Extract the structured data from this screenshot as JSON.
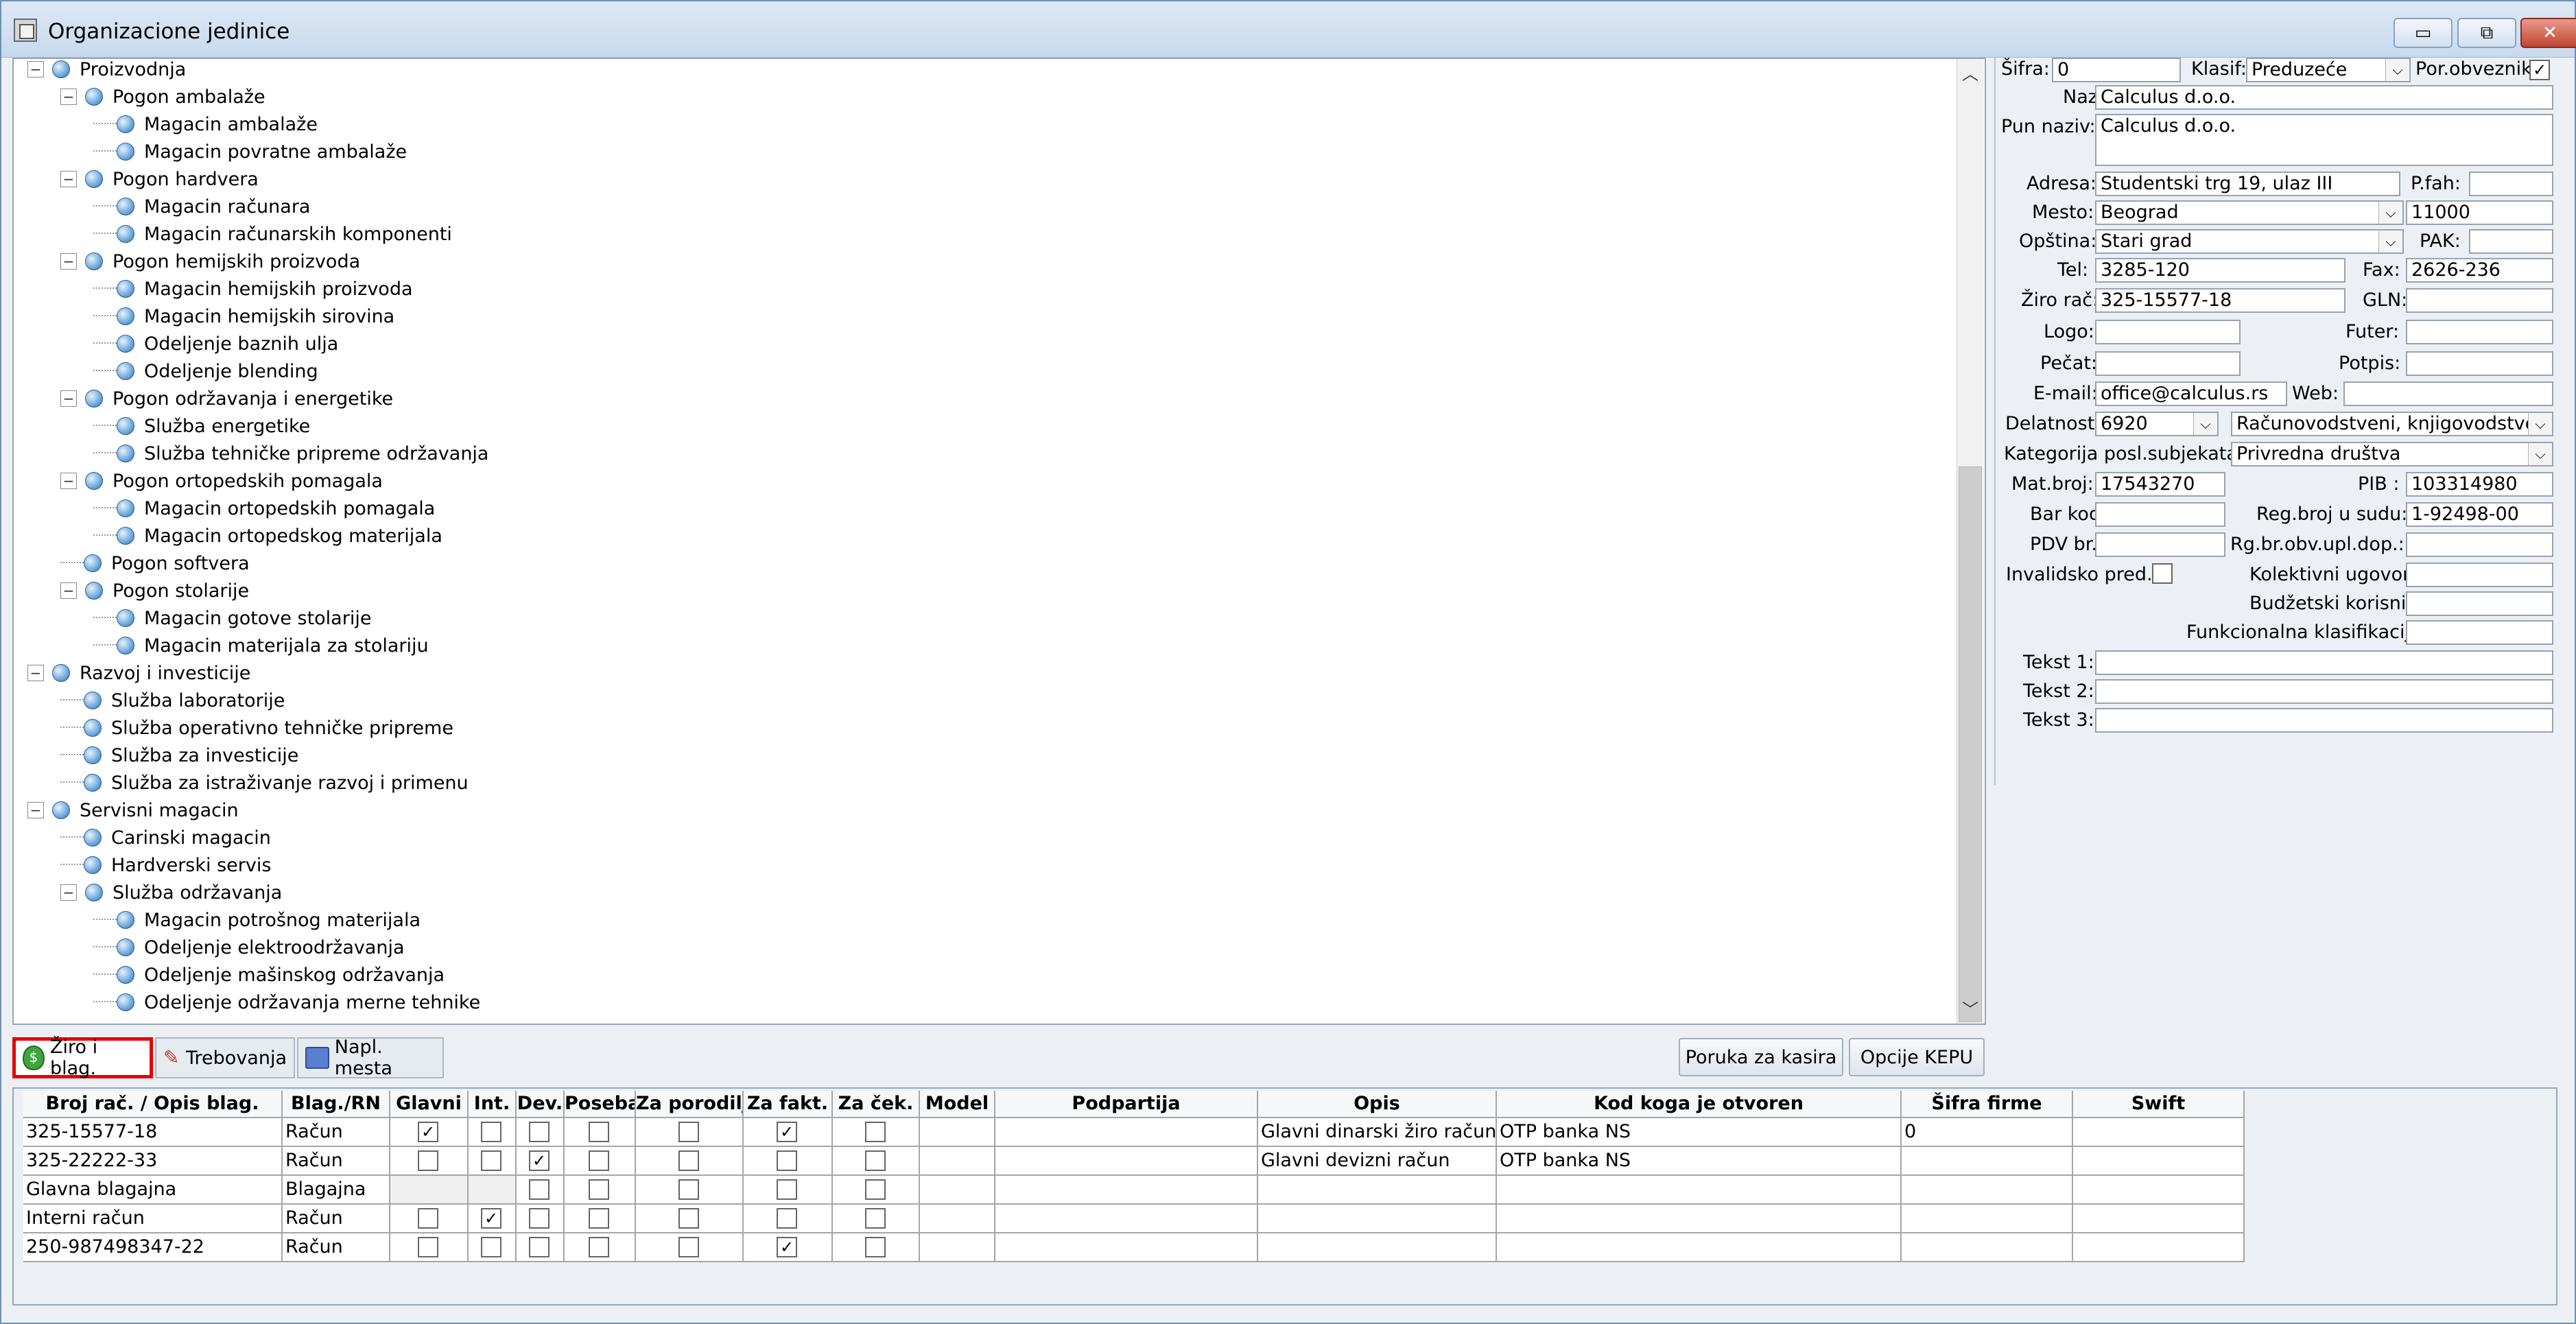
{
  "window": {
    "title": "Organizacione jedinice",
    "title_buttons": [
      "▭",
      "⧉",
      "✕"
    ]
  },
  "tree": [
    {
      "label": "Proizvodnja",
      "level": 0,
      "expandable": true
    },
    {
      "label": "Pogon ambalaže",
      "level": 1,
      "expandable": true
    },
    {
      "label": "Magacin ambalaže",
      "level": 2,
      "expandable": false
    },
    {
      "label": "Magacin povratne ambalaže",
      "level": 2,
      "expandable": false
    },
    {
      "label": "Pogon hardvera",
      "level": 1,
      "expandable": true
    },
    {
      "label": "Magacin računara",
      "level": 2,
      "expandable": false
    },
    {
      "label": "Magacin računarskih komponenti",
      "level": 2,
      "expandable": false
    },
    {
      "label": "Pogon hemijskih proizvoda",
      "level": 1,
      "expandable": true
    },
    {
      "label": "Magacin hemijskih proizvoda",
      "level": 2,
      "expandable": false
    },
    {
      "label": "Magacin hemijskih sirovina",
      "level": 2,
      "expandable": false
    },
    {
      "label": "Odeljenje baznih ulja",
      "level": 2,
      "expandable": false
    },
    {
      "label": "Odeljenje blending",
      "level": 2,
      "expandable": false
    },
    {
      "label": "Pogon održavanja i energetike",
      "level": 1,
      "expandable": true
    },
    {
      "label": "Služba energetike",
      "level": 2,
      "expandable": false
    },
    {
      "label": "Služba tehničke pripreme održavanja",
      "level": 2,
      "expandable": false
    },
    {
      "label": "Pogon ortopedskih pomagala",
      "level": 1,
      "expandable": true
    },
    {
      "label": "Magacin ortopedskih pomagala",
      "level": 2,
      "expandable": false
    },
    {
      "label": "Magacin ortopedskog materijala",
      "level": 2,
      "expandable": false
    },
    {
      "label": "Pogon softvera",
      "level": 1,
      "expandable": false
    },
    {
      "label": "Pogon stolarije",
      "level": 1,
      "expandable": true
    },
    {
      "label": "Magacin gotove stolarije",
      "level": 2,
      "expandable": false
    },
    {
      "label": "Magacin materijala za stolariju",
      "level": 2,
      "expandable": false
    },
    {
      "label": "Razvoj i investicije",
      "level": 0,
      "expandable": true
    },
    {
      "label": "Služba laboratorije",
      "level": 1,
      "expandable": false
    },
    {
      "label": "Služba operativno tehničke pripreme",
      "level": 1,
      "expandable": false
    },
    {
      "label": "Služba za investicije",
      "level": 1,
      "expandable": false
    },
    {
      "label": "Služba za istraživanje razvoj i primenu",
      "level": 1,
      "expandable": false
    },
    {
      "label": "Servisni magacin",
      "level": 0,
      "expandable": true
    },
    {
      "label": "Carinski magacin",
      "level": 1,
      "expandable": false
    },
    {
      "label": "Hardverski servis",
      "level": 1,
      "expandable": false
    },
    {
      "label": "Služba održavanja",
      "level": 1,
      "expandable": true
    },
    {
      "label": "Magacin potrošnog materijala",
      "level": 2,
      "expandable": false
    },
    {
      "label": "Odeljenje elektroodržavanja",
      "level": 2,
      "expandable": false
    },
    {
      "label": "Odeljenje mašinskog održavanja",
      "level": 2,
      "expandable": false
    },
    {
      "label": "Odeljenje održavanja merne tehnike",
      "level": 2,
      "expandable": false
    }
  ],
  "form": {
    "sifra_label": "Šifra:",
    "sifra": "0",
    "klasif_label": "Klasif:",
    "klasif": "Preduzeće",
    "porobv_label": "Por.obveznik:",
    "porobv_checked": "✓",
    "naziv_label": "Naziv:",
    "naziv": "Calculus d.o.o.",
    "punnaziv_label": "Pun naziv:",
    "punnaziv": "Calculus d.o.o.",
    "adresa_label": "Adresa:",
    "adresa": "Studentski trg 19, ulaz III",
    "pfah_label": "P.fah:",
    "pfah": "",
    "mesto_label": "Mesto:",
    "mesto": "Beograd",
    "ptt": "11000",
    "opstina_label": "Opština:",
    "opstina": "Stari grad",
    "pak_label": "PAK:",
    "pak": "",
    "tel_label": "Tel:",
    "tel": "3285-120",
    "fax_label": "Fax:",
    "fax": "2626-236",
    "ziro_label": "Žiro rač:",
    "ziro": "325-15577-18",
    "gln_label": "GLN:",
    "gln": "",
    "logo_label": "Logo:",
    "logo": "",
    "futer_label": "Futer:",
    "futer": "",
    "pecat_label": "Pečat:",
    "pecat": "",
    "potpis_label": "Potpis:",
    "potpis": "",
    "email_label": "E-mail:",
    "email": "office@calculus.rs",
    "web_label": "Web:",
    "web": "",
    "delatnost_label": "Delatnost:",
    "delatnost": "6920",
    "delatnost_opis": "Računovodstveni, knjigovodstven",
    "kategorija_label": "Kategorija posl.subjekata:",
    "kategorija": "Privredna društva",
    "matbroj_label": "Mat.broj:",
    "matbroj": "17543270",
    "pib_label": "PIB :",
    "pib": "103314980",
    "barkod_label": "Bar kod:",
    "barkod": "",
    "regbroj_label": "Reg.broj u sudu:",
    "regbroj": "1-92498-00",
    "pdv_label": "PDV br.:",
    "pdv": "",
    "rgbr_label": "Rg.br.obv.upl.dop.:",
    "rgbr": "",
    "invalid_label": "Invalidsko pred.:",
    "kolektivni_label": "Kolektivni ugovor:",
    "kolektivni": "",
    "budzetski_label": "Budžetski korisnik:",
    "budzetski": "",
    "funkcionalna_label": "Funkcionalna klasifikacija:",
    "funkcionalna": "",
    "tekst1_label": "Tekst 1:",
    "tekst1": "",
    "tekst2_label": "Tekst 2:",
    "tekst2": "",
    "tekst3_label": "Tekst 3:",
    "tekst3": ""
  },
  "tabs": [
    {
      "label": "Žiro i blag.",
      "icon": "money-bag-icon",
      "active": true
    },
    {
      "label": "Trebovanja",
      "icon": "wrench-icon",
      "active": false
    },
    {
      "label": "Napl. mesta",
      "icon": "cash-register-icon",
      "active": false
    }
  ],
  "buttons": {
    "poruka": "Poruka za kasira",
    "opcije": "Opcije KEPU"
  },
  "grid": {
    "columns": [
      "Broj rač. / Opis blag.",
      "Blag./RN",
      "Glavni",
      "Int.",
      "Dev.",
      "Poseban",
      "Za porodilje",
      "Za fakt.",
      "Za ček.",
      "Model",
      "Podpartija",
      "Opis",
      "Kod koga je otvoren",
      "Šifra firme",
      "Swift"
    ],
    "rows": [
      {
        "broj": " 325-15577-18",
        "blag": "Račun",
        "glavni": "✓",
        "int": "",
        "dev": "",
        "poseban": "",
        "porodilje": "",
        "fakt": "✓",
        "cek": "",
        "model": "",
        "podpartija": "",
        "opis": "Glavni dinarski žiro račun",
        "kod": "OTP banka NS",
        "sifra": "0",
        "swift": ""
      },
      {
        "broj": "325-22222-33",
        "blag": "Račun",
        "glavni": "",
        "int": "",
        "dev": "✓",
        "poseban": "",
        "porodilje": "",
        "fakt": "",
        "cek": "",
        "model": "",
        "podpartija": "",
        "opis": "Glavni devizni račun",
        "kod": "OTP banka NS",
        "sifra": "",
        "swift": ""
      },
      {
        "broj": "Glavna blagajna",
        "blag": "Blagajna",
        "glavni": null,
        "int": null,
        "dev": "",
        "poseban": "",
        "porodilje": "",
        "fakt": "",
        "cek": "",
        "model": "",
        "podpartija": "",
        "opis": "",
        "kod": "",
        "sifra": "",
        "swift": ""
      },
      {
        "broj": "Interni račun",
        "blag": "Račun",
        "glavni": "",
        "int": "✓",
        "dev": "",
        "poseban": "",
        "porodilje": "",
        "fakt": "",
        "cek": "",
        "model": "",
        "podpartija": "",
        "opis": "",
        "kod": "",
        "sifra": "",
        "swift": ""
      },
      {
        "broj": "250-987498347-22",
        "blag": "Račun",
        "glavni": "",
        "int": "",
        "dev": "",
        "poseban": "",
        "porodilje": "",
        "fakt": "✓",
        "cek": "",
        "model": "",
        "podpartija": "",
        "opis": "",
        "kod": "",
        "sifra": "",
        "swift": ""
      }
    ]
  },
  "colors": {
    "highlight": "#e60000",
    "globe": "#6ea7db"
  }
}
